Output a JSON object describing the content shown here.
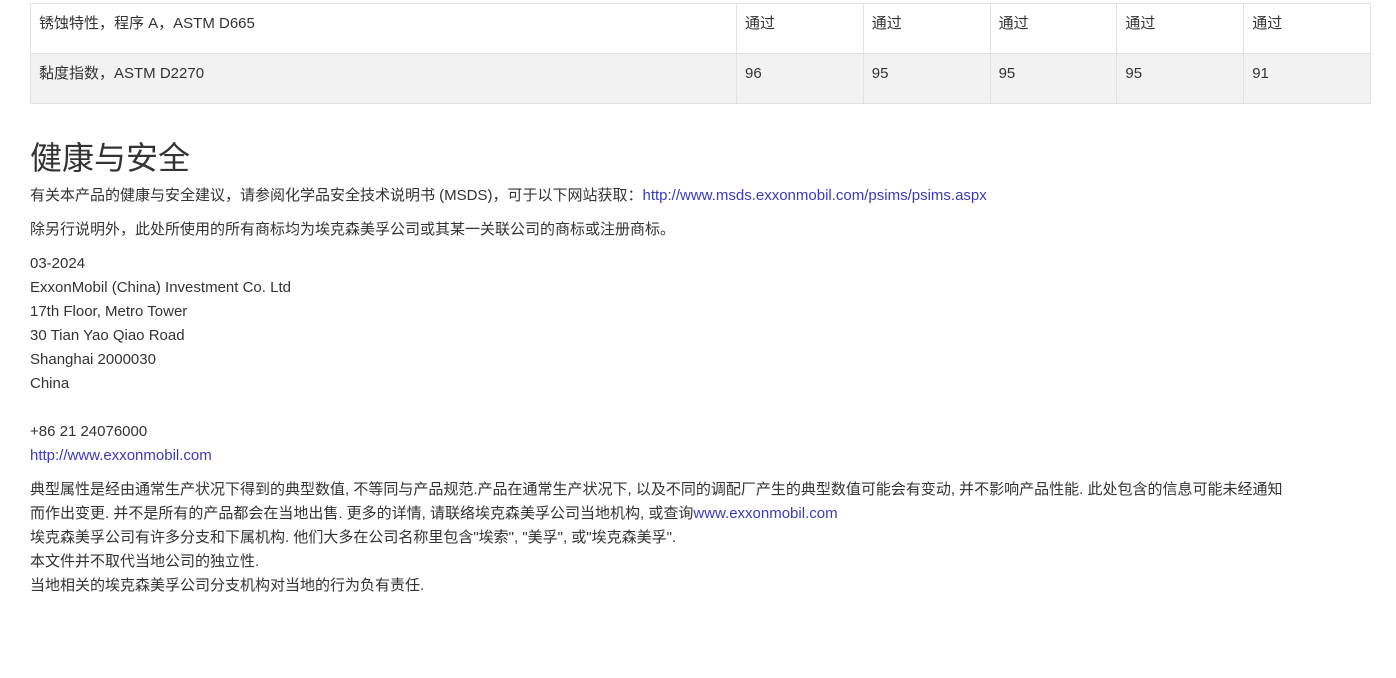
{
  "table": {
    "rows": [
      {
        "label": "锈蚀特性，程序 A，ASTM D665",
        "values": [
          "通过",
          "通过",
          "通过",
          "通过",
          "通过"
        ]
      },
      {
        "label": "黏度指数，ASTM D2270",
        "values": [
          "96",
          "95",
          "95",
          "95",
          "91"
        ]
      }
    ]
  },
  "health": {
    "title": "健康与安全",
    "msds_text": "有关本产品的健康与安全建议，请参阅化学品安全技术说明书 (MSDS)，可于以下网站获取：",
    "msds_link": "http://www.msds.exxonmobil.com/psims/psims.aspx",
    "trademark_text": "除另行说明外，此处所使用的所有商标均为埃克森美孚公司或其某一关联公司的商标或注册商标。"
  },
  "address": {
    "date": "03-2024",
    "company": "ExxonMobil (China) Investment Co. Ltd",
    "floor": "17th Floor, Metro Tower",
    "street": "30 Tian Yao Qiao Road",
    "city": "Shanghai 2000030",
    "country": "China",
    "phone": "+86 21 24076000",
    "website": "http://www.exxonmobil.com"
  },
  "disclaimer": {
    "line1": "典型属性是经由通常生产状况下得到的典型数值, 不等同与产品规范.产品在通常生产状况下, 以及不同的调配厂产生的典型数值可能会有变动, 并不影响产品性能. 此处包含的信息可能未经通知",
    "line2": "而作出变更. 并不是所有的产品都会在当地出售. 更多的详情, 请联络埃克森美孚公司当地机构, 或查询",
    "line2_link": "www.exxonmobil.com",
    "line3": "埃克森美孚公司有许多分支和下属机构. 他们大多在公司名称里包含\"埃索\", \"美孚\", 或\"埃克森美孚\".",
    "line4": "本文件并不取代当地公司的独立性.",
    "line5": "当地相关的埃克森美孚公司分支机构对当地的行为负有责任."
  }
}
